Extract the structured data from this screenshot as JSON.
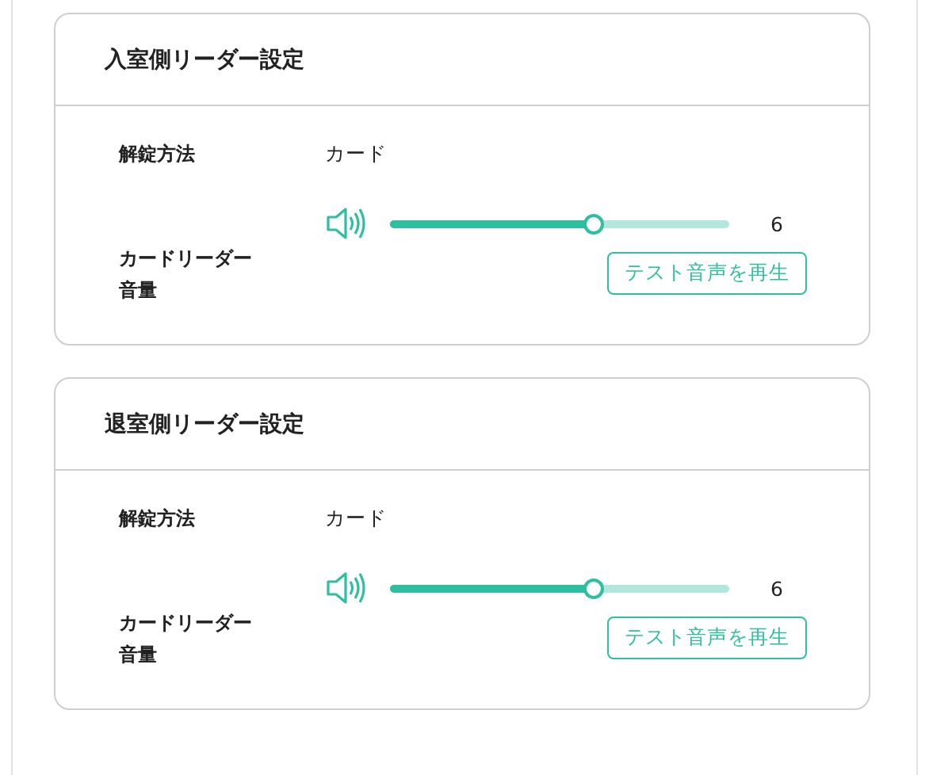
{
  "cards": [
    {
      "title": "入室側リーダー設定",
      "unlock_label": "解錠方法",
      "unlock_value": "カード",
      "volume_label": "カードリーダー音量",
      "volume": {
        "level": 0.6,
        "reading": "6"
      },
      "test_button": "テスト音声を再生"
    },
    {
      "title": "退室側リーダー設定",
      "unlock_label": "解錠方法",
      "unlock_value": "カード",
      "volume_label": "カードリーダー音量",
      "volume": {
        "level": 0.6,
        "reading": "6"
      },
      "test_button": "テスト音声を再生"
    }
  ]
}
